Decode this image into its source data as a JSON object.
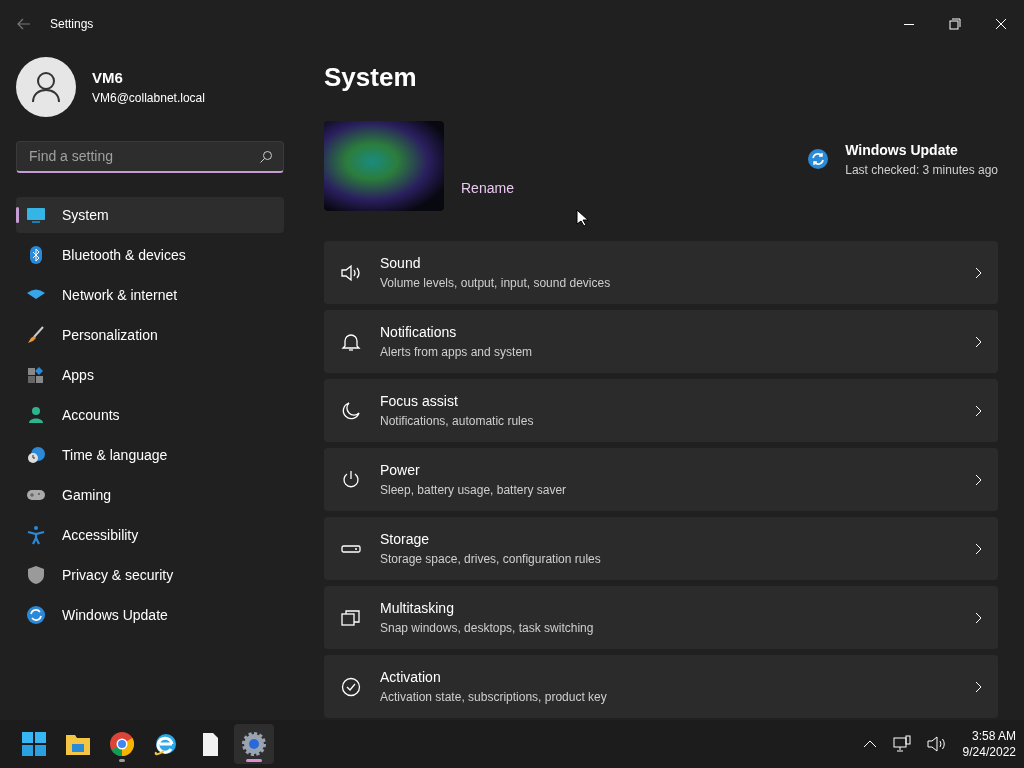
{
  "window": {
    "title": "Settings"
  },
  "account": {
    "name": "VM6",
    "email": "VM6@collabnet.local"
  },
  "search": {
    "placeholder": "Find a setting"
  },
  "nav": [
    {
      "label": "System",
      "kind": "system",
      "selected": true
    },
    {
      "label": "Bluetooth & devices",
      "kind": "bluetooth",
      "selected": false
    },
    {
      "label": "Network & internet",
      "kind": "network",
      "selected": false
    },
    {
      "label": "Personalization",
      "kind": "brush",
      "selected": false
    },
    {
      "label": "Apps",
      "kind": "apps",
      "selected": false
    },
    {
      "label": "Accounts",
      "kind": "accounts",
      "selected": false
    },
    {
      "label": "Time & language",
      "kind": "time",
      "selected": false
    },
    {
      "label": "Gaming",
      "kind": "gaming",
      "selected": false
    },
    {
      "label": "Accessibility",
      "kind": "accessibility",
      "selected": false
    },
    {
      "label": "Privacy & security",
      "kind": "shield",
      "selected": false
    },
    {
      "label": "Windows Update",
      "kind": "update",
      "selected": false
    }
  ],
  "page_title": "System",
  "device": {
    "rename": "Rename"
  },
  "update": {
    "title": "Windows Update",
    "status": "Last checked: 3 minutes ago"
  },
  "settings": [
    {
      "title": "Sound",
      "subtitle": "Volume levels, output, input, sound devices",
      "kind": "sound"
    },
    {
      "title": "Notifications",
      "subtitle": "Alerts from apps and system",
      "kind": "bell"
    },
    {
      "title": "Focus assist",
      "subtitle": "Notifications, automatic rules",
      "kind": "moon"
    },
    {
      "title": "Power",
      "subtitle": "Sleep, battery usage, battery saver",
      "kind": "power"
    },
    {
      "title": "Storage",
      "subtitle": "Storage space, drives, configuration rules",
      "kind": "storage"
    },
    {
      "title": "Multitasking",
      "subtitle": "Snap windows, desktops, task switching",
      "kind": "multitask"
    },
    {
      "title": "Activation",
      "subtitle": "Activation state, subscriptions, product key",
      "kind": "check"
    }
  ],
  "taskbar": {
    "apps": [
      {
        "kind": "start",
        "running": false,
        "active": false
      },
      {
        "kind": "explorer",
        "running": false,
        "active": false
      },
      {
        "kind": "chrome",
        "running": true,
        "active": false
      },
      {
        "kind": "ie",
        "running": false,
        "active": false
      },
      {
        "kind": "file",
        "running": false,
        "active": false
      },
      {
        "kind": "settings",
        "running": true,
        "active": true
      }
    ],
    "time": "3:58 AM",
    "date": "9/24/2022"
  }
}
